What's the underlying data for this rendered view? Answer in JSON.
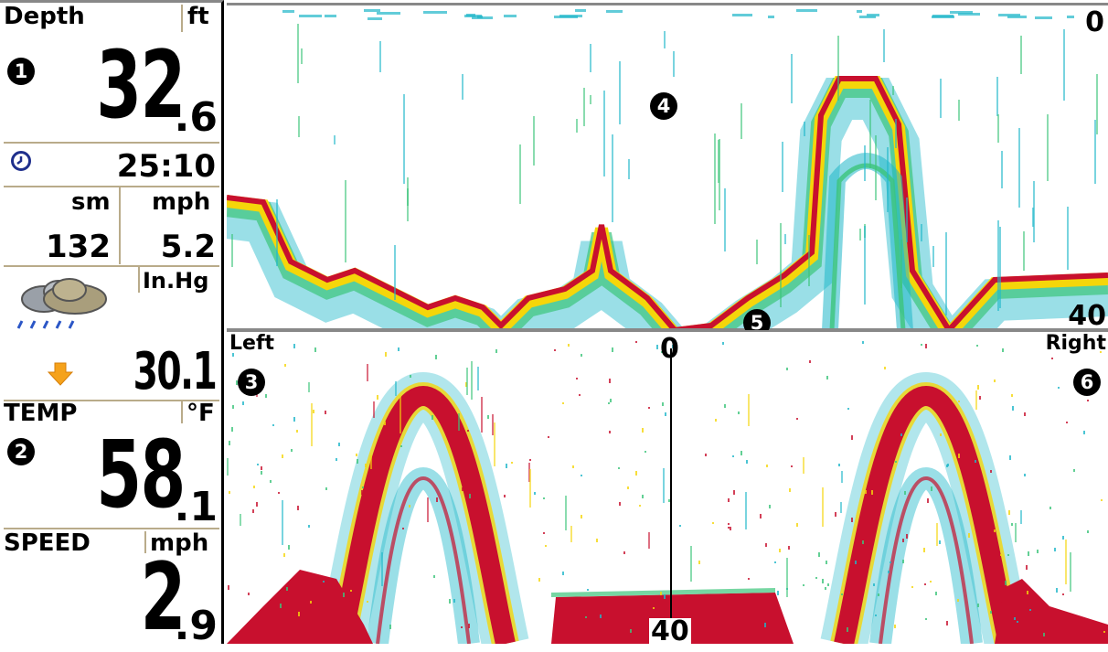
{
  "panel": {
    "depth": {
      "label": "Depth",
      "unit": "ft",
      "value": "32",
      "decimal": ".6"
    },
    "timer": {
      "value": "25:10"
    },
    "distance": {
      "unit": "sm",
      "value": "132"
    },
    "speed_small": {
      "unit": "mph",
      "value": "5.2"
    },
    "weather_icon": "rain-cloud-icon",
    "pressure": {
      "unit": "In.Hg",
      "value": "30.1",
      "trend_icon": "arrow-down-icon"
    },
    "temp": {
      "label": "TEMP",
      "unit": "°F",
      "value": "58",
      "decimal": ".1"
    },
    "speed": {
      "label": "SPEED",
      "unit": "mph",
      "value": "2",
      "decimal": ".9"
    }
  },
  "callouts": [
    "1",
    "2",
    "3",
    "4",
    "5",
    "6"
  ],
  "top_view": {
    "scale_top": "0",
    "scale_bottom": "40"
  },
  "side_view": {
    "left_label": "Left",
    "right_label": "Right",
    "center_top": "0",
    "center_bottom": "40"
  },
  "colors": {
    "strong": "#c8102e",
    "mid": "#f5d60a",
    "weak": "#1fb7c9",
    "clutter": "#3cc47a"
  }
}
